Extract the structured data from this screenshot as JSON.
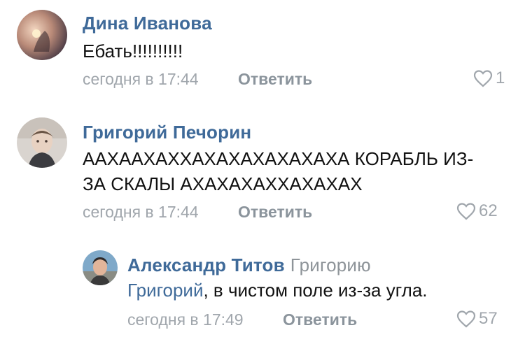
{
  "comments": [
    {
      "author": "Дина Иванова",
      "lines": [
        "Ебать!!!!!!!!!!"
      ],
      "time": "сегодня в 17:44",
      "reply_label": "Ответить",
      "likes": "1"
    },
    {
      "author": "Григорий Печорин",
      "lines": [
        "ААХААХАХХАХАХАХАХАХАХА КОРАБЛЬ ИЗ-",
        "ЗА СКАЛЫ АХАХАХАХХАХАХАХ"
      ],
      "time": "сегодня в 17:44",
      "reply_label": "Ответить",
      "likes": "62"
    },
    {
      "author": "Александр Титов",
      "reply_to": "Григорию",
      "mention": "Григорий",
      "text_rest": ", в чистом поле из-за угла.",
      "time": "сегодня в 17:49",
      "reply_label": "Ответить",
      "likes": "57"
    }
  ]
}
